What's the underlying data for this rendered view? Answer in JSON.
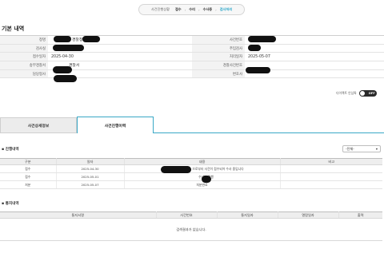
{
  "progress": {
    "label": "사건진행상황",
    "steps": [
      "접수",
      "수리",
      "수사중",
      "검사처리"
    ],
    "separator": "›",
    "current_step": "검사처리"
  },
  "basic_info": {
    "title": "기본 내역",
    "rows": [
      {
        "label_left": "청명",
        "value_left": "경찰청",
        "label_right": "사건번호",
        "value_right": ""
      },
      {
        "label_left": "검사실",
        "value_left": "",
        "label_right": "주임검사",
        "value_right": ""
      },
      {
        "label_left": "접수일자",
        "value_left": "2025-04-30",
        "label_right": "처리일자",
        "value_right": "2025-05-07"
      },
      {
        "label_left": "송부경찰서",
        "value_left": "경찰서",
        "label_right": "경찰사건번호",
        "value_right": ""
      },
      {
        "label_left": "담당형사",
        "value_left": "",
        "label_right": "변호사",
        "value_right": ""
      }
    ]
  },
  "toggle": {
    "label": "다이렉트 안심톡",
    "state": "OFF"
  },
  "tabs": {
    "detail": "사건상세정보",
    "progress": "사건진행이력"
  },
  "progress_history": {
    "title": "진행내역",
    "filter_value": "-전체-",
    "columns": [
      "구분",
      "일자",
      "내용",
      "비고"
    ],
    "rows": [
      {
        "type": "접수",
        "date": "2025-04-30",
        "content": "으로부터 사건이 접수되어 수사 중입니다",
        "note": ""
      },
      {
        "type": "접수",
        "date": "2025-05-01",
        "content": "수사가 진행",
        "note": ""
      },
      {
        "type": "처분",
        "date": "2025-05-07",
        "content": "처분완료",
        "note": ""
      }
    ]
  },
  "notice_history": {
    "title": "통지내역",
    "columns": [
      "통지서명",
      "사건번호",
      "통지일자",
      "열람일자",
      "출력"
    ],
    "empty_message": "검색결과가 없습니다."
  },
  "colors": {
    "accent": "#2aa6c9",
    "tab_border": "#3aa8c6",
    "redaction": "#111111"
  }
}
